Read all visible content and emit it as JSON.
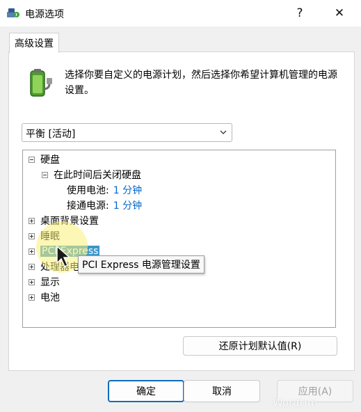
{
  "window": {
    "title": "电源选项",
    "help_glyph": "?",
    "close_glyph": "✕"
  },
  "tab": {
    "label": "高级设置"
  },
  "intro": {
    "text": "选择你要自定义的电源计划，然后选择你希望计算机管理的电源设置。"
  },
  "plan_select": {
    "value": "平衡 [活动]"
  },
  "tree": {
    "hard_disk": {
      "label": "硬盘",
      "turn_off": {
        "label": "在此时间后关闭硬盘",
        "on_battery_label": "使用电池:",
        "on_battery_value": "1 分钟",
        "plugged_in_label": "接通电源:",
        "plugged_in_value": "1 分钟"
      }
    },
    "desktop_bg": {
      "label": "桌面背景设置"
    },
    "sleep": {
      "label": "睡眠"
    },
    "pci_express": {
      "label": "PCI Express"
    },
    "processor": {
      "label": "处理器电源管理"
    },
    "display": {
      "label": "显示"
    },
    "battery": {
      "label": "电池"
    }
  },
  "tooltip": {
    "text": "PCI Express 电源管理设置"
  },
  "buttons": {
    "restore": "还原计划默认值(R)",
    "ok": "确定",
    "cancel": "取消",
    "apply": "应用(A)"
  },
  "watermark": {
    "text": "WordHm"
  },
  "colors": {
    "accent": "#0f6cbd",
    "link": "#0066cc",
    "selection": "#3c95c8",
    "highlight": "#faf078"
  }
}
